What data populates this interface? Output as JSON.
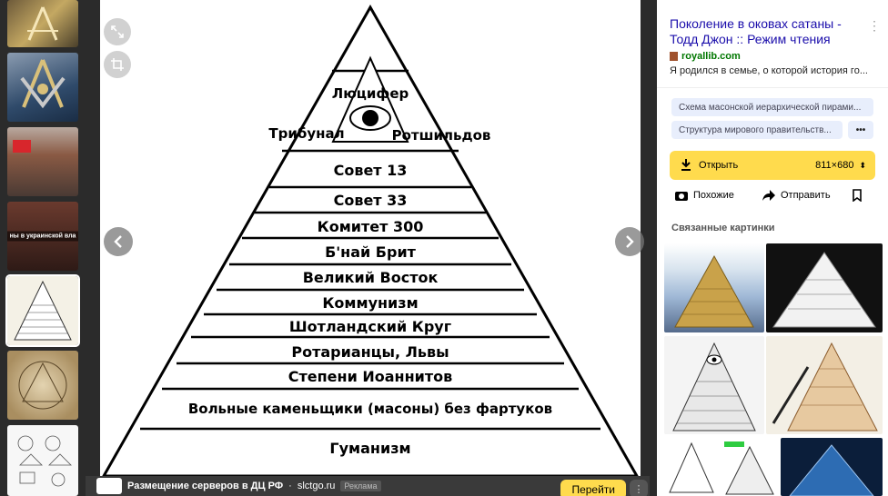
{
  "thumbnails": [
    {
      "name": "thumb-masonic-emblem",
      "caption": ""
    },
    {
      "name": "thumb-masonic-square-compass",
      "caption": ""
    },
    {
      "name": "thumb-building-street",
      "caption": ""
    },
    {
      "name": "thumb-ukrainian-news",
      "caption": "ны в украинской вла"
    },
    {
      "name": "thumb-pyramid-selected",
      "caption": ""
    },
    {
      "name": "thumb-vitruvian-drawing",
      "caption": ""
    },
    {
      "name": "thumb-symbols-sheet",
      "caption": ""
    }
  ],
  "pyramid": {
    "tiers": [
      "Люцифер",
      "Трибунал",
      "Ротшильдов",
      "Совет 13",
      "Совет 33",
      "Комитет 300",
      "Б'най Брит",
      "Великий Восток",
      "Коммунизм",
      "Шотландский Круг",
      "Ротарианцы, Львы",
      "Степени Иоаннитов",
      "Вольные каменьщики (масоны) без фартуков",
      "Гуманизм"
    ]
  },
  "viewer": {
    "expand_icon": "expand-icon",
    "crop_icon": "crop-icon",
    "prev_icon": "chevron-left-icon",
    "next_icon": "chevron-right-icon"
  },
  "ad": {
    "title": "Размещение серверов в ДЦ РФ",
    "separator": "·",
    "domain": "slctgo.ru",
    "tag": "Реклама",
    "cta": "Перейти"
  },
  "source": {
    "title": "Поколение в оковах сатаны - Тодд Джон :: Режим чтения",
    "domain": "royallib.com",
    "snippet": "Я родился в семье, о которой история го..."
  },
  "chips": [
    "Схема масонской иерархической пирами...",
    "Структура мирового правительств..."
  ],
  "chips_more": "•••",
  "open": {
    "label": "Открыть",
    "size": "811×680",
    "caret": "⬍"
  },
  "actions": {
    "similar": "Похожие",
    "share": "Отправить"
  },
  "related": {
    "title": "Связанные картинки"
  },
  "colors": {
    "accent": "#ffdb4d",
    "link": "#1a0dab",
    "domain": "#007700",
    "chip_bg": "#e8eefc",
    "dark_bg": "#2b2b2b"
  }
}
